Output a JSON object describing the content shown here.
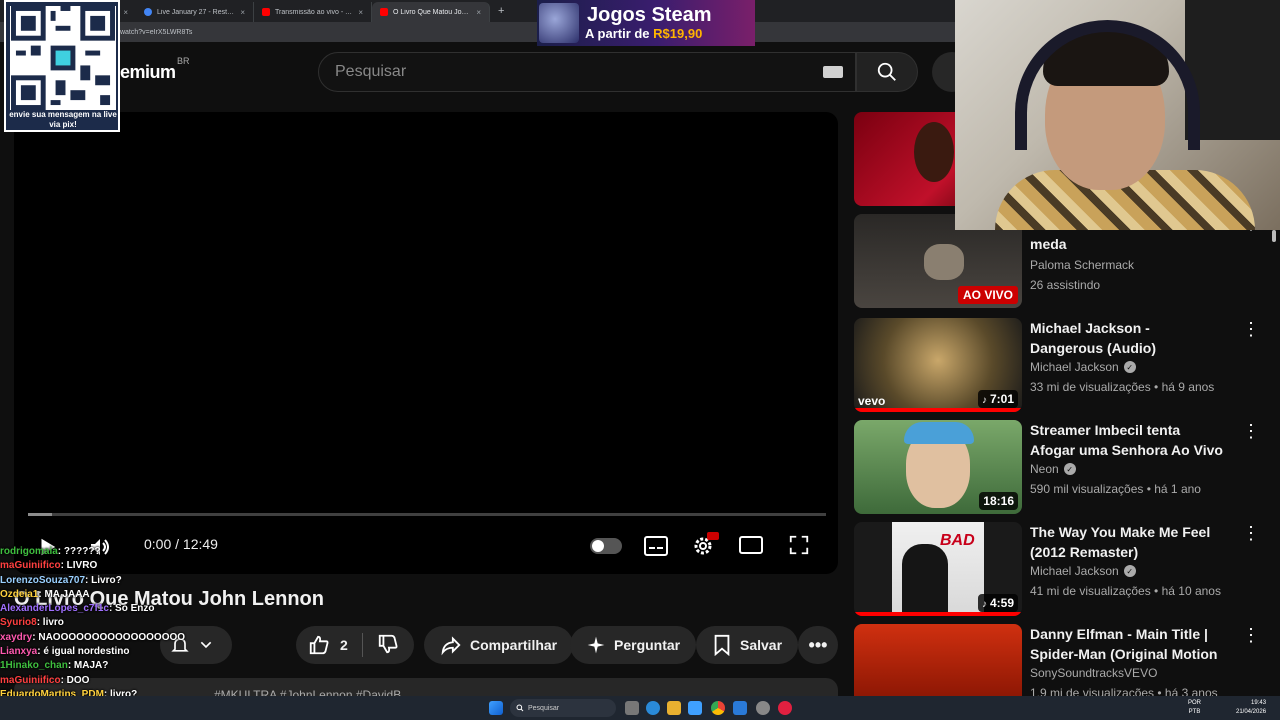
{
  "browser": {
    "tabs": [
      {
        "label": "",
        "favicon": "tab-icon"
      },
      {
        "label": "Live January 27 - Restream",
        "favicon": "restream-icon"
      },
      {
        "label": "Transmissão ao vivo - YouTube",
        "favicon": "youtube-icon"
      },
      {
        "label": "O Livro Que Matou John Lennon",
        "favicon": "youtube-icon"
      }
    ],
    "close_glyph": "×",
    "new_tab": "+",
    "url": "/watch?v=eIrX5LWR8Ts"
  },
  "header": {
    "logo_text": "emium",
    "logo_region": "BR",
    "search_placeholder": "Pesquisar"
  },
  "overlay": {
    "qr_caption": "envie sua mensagem na live via pix!",
    "ad_line1": "Jogos Steam",
    "ad_line2_prefix": "A partir de ",
    "ad_line2_price": "R$19,90"
  },
  "player": {
    "current_time": "0:00",
    "separator": " / ",
    "duration": "12:49",
    "progress_fraction": 0.03
  },
  "video": {
    "title": "O Livro Que Matou John Lennon",
    "like_count": "2",
    "share_label": "Compartilhar",
    "ask_label": "Perguntar",
    "save_label": "Salvar",
    "desc_tags": "#MKULTRA  #JohnLennon  #DavidB..."
  },
  "sidebar": {
    "items": [
      {
        "title": "",
        "channel": "",
        "meta": "",
        "badge": ""
      },
      {
        "title": "meda",
        "channel": "Paloma Schermack",
        "meta": "26 assistindo",
        "badge": "AO VIVO",
        "verified": false
      },
      {
        "title": "Michael Jackson - Dangerous (Audio)",
        "channel": "Michael Jackson",
        "meta": "33 mi de visualizações • há 9 anos",
        "badge": "7:01",
        "verified": true
      },
      {
        "title": "Streamer Imbecil tenta Afogar uma Senhora Ao Vivo",
        "channel": "Neon",
        "meta": "590 mil visualizações • há 1 ano",
        "badge": "18:16",
        "verified": true
      },
      {
        "title": "The Way You Make Me Feel (2012 Remaster)",
        "channel": "Michael Jackson",
        "meta": "41 mi de visualizações • há 10 anos",
        "badge": "4:59",
        "verified": true
      },
      {
        "title": "Danny Elfman - Main Title | Spider-Man (Original Motion ...",
        "channel": "SonySoundtracksVEVO",
        "meta": "1,9 mi de visualizações • há 3 anos",
        "badge": "",
        "verified": false
      }
    ],
    "vevo_label": "vevo",
    "bad_label": "BAD"
  },
  "chat": [
    {
      "user": "rodrigomaia",
      "text": ": ??????",
      "color": "#3fbf3f"
    },
    {
      "user": "maGuiniifico",
      "text": ": LIVRO",
      "color": "#ff4040"
    },
    {
      "user": "LorenzoSouza707",
      "text": ": Livro?",
      "color": "#9ad0ff"
    },
    {
      "user": "Ozdeia1",
      "text": ": MA JAAA",
      "color": "#ffd23f"
    },
    {
      "user": "AlexanderLopes_c7f1c",
      "text": ": So Enzo",
      "color": "#a070ff"
    },
    {
      "user": "Syurio8",
      "text": ": livro",
      "color": "#ff4040"
    },
    {
      "user": "xaydry",
      "text": ": NAOOOOOOOOOOOOOOOOO",
      "color": "#ff5ab0"
    },
    {
      "user": "Lianxya",
      "text": ": é igual nordestino",
      "color": "#ff5ab0"
    },
    {
      "user": "1Hinako_chan",
      "text": ": MAJA?",
      "color": "#3fbf3f"
    },
    {
      "user": "maGuiniifico",
      "text": ": DOO",
      "color": "#ff4040"
    },
    {
      "user": "EduardoMartins_PDM",
      "text": ": livro?",
      "color": "#ffd23f"
    }
  ],
  "taskbar": {
    "search_label": "Pesquisar",
    "lang_top": "POR",
    "lang_bottom": "PTB",
    "time": "19:43",
    "date": "21/04/2026"
  },
  "colors": {
    "accent": "#ff0000",
    "background": "#0f0f0f",
    "surface": "#272727"
  }
}
